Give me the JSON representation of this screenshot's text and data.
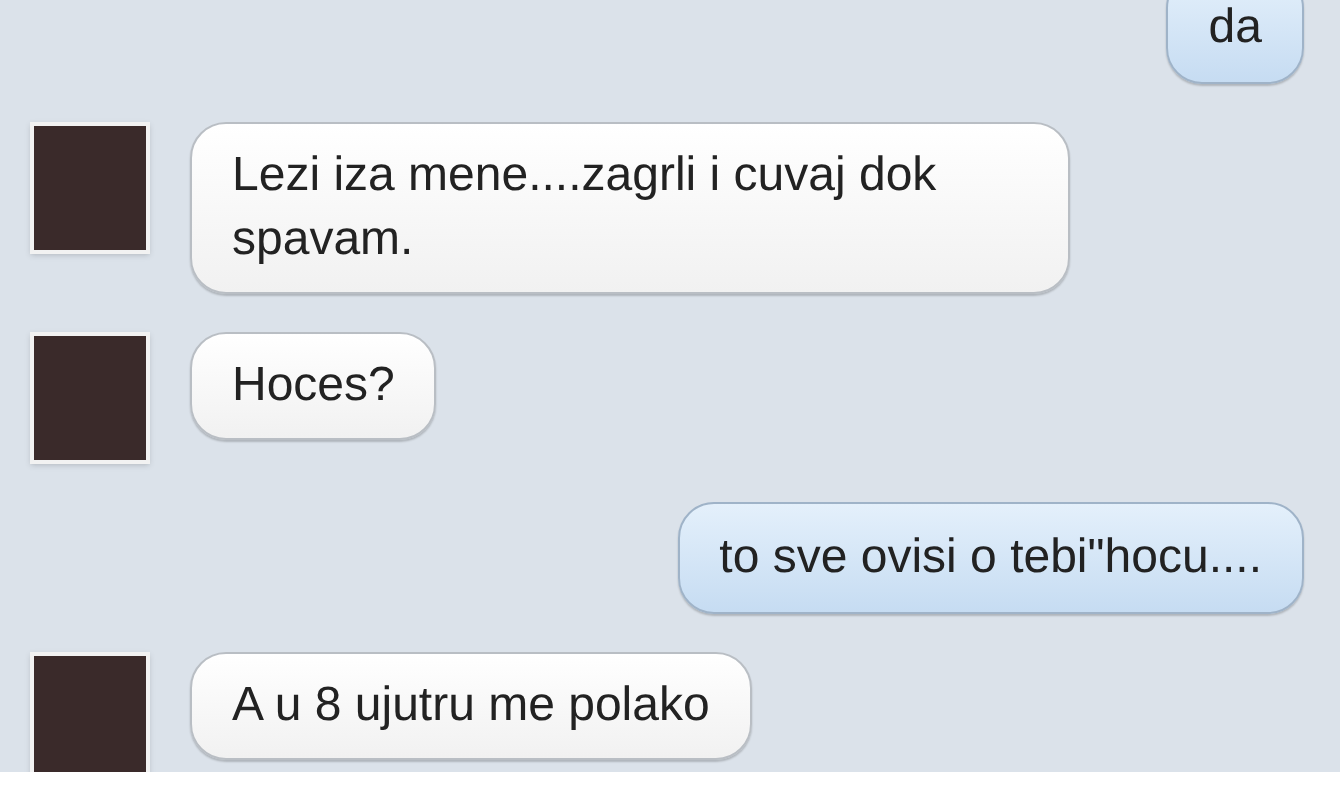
{
  "messages": [
    {
      "kind": "outgoing",
      "text": "da"
    },
    {
      "kind": "incoming",
      "text": "Lezi iza mene....zagrli i cuvaj dok spavam."
    },
    {
      "kind": "incoming",
      "text": "Hoces?"
    },
    {
      "kind": "outgoing",
      "text": "to sve ovisi o tebi\"hocu...."
    },
    {
      "kind": "incoming",
      "text": "A u 8 ujutru me polako"
    }
  ]
}
